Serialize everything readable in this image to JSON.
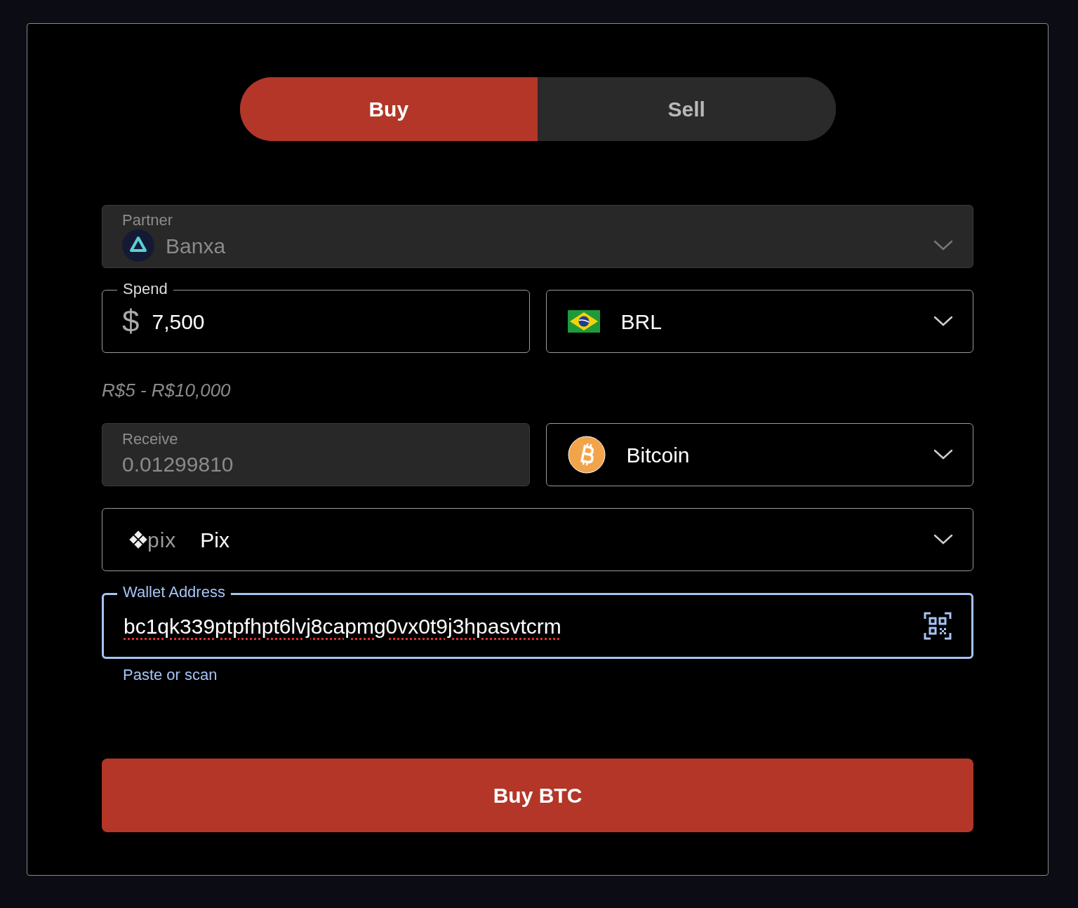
{
  "tabs": [
    {
      "label": "Buy",
      "selected": true
    },
    {
      "label": "Sell",
      "selected": false
    }
  ],
  "partner": {
    "label": "Partner",
    "value": "Banxa",
    "disabled": true
  },
  "spend": {
    "label": "Spend",
    "currency_symbol": "$",
    "value": "7,500"
  },
  "spend_currency": {
    "value": "BRL"
  },
  "range_hint": "R$5 - R$10,000",
  "receive": {
    "label": "Receive",
    "value": "0.01299810",
    "disabled": true
  },
  "receive_asset": {
    "value": "Bitcoin"
  },
  "payment_method": {
    "logo_text": "pix",
    "value": "Pix"
  },
  "wallet": {
    "label": "Wallet Address",
    "value": "bc1qk339ptpfhpt6lvj8capmg0vx0t9j3hpasvtcrm",
    "focused": true,
    "helper": "Paste or scan"
  },
  "submit": {
    "label": "Buy BTC"
  }
}
